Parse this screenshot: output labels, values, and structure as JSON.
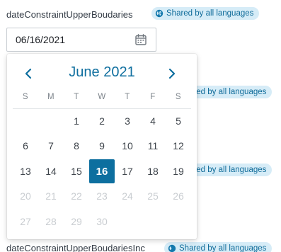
{
  "fields": [
    {
      "label": "dateConstraintUpperBoudaries",
      "badge": "Shared by all languages"
    },
    {
      "badge": "Shared by all languages"
    },
    {
      "badge": "Shared by all languages"
    },
    {
      "label": "dateConstraintUpperBoudariesInc",
      "badge": "Shared by all languages"
    }
  ],
  "date_input": {
    "value": "06/16/2021",
    "icon": "calendar-icon"
  },
  "picker": {
    "month_title": "June 2021",
    "prev_icon": "chevron-left-icon",
    "next_icon": "chevron-right-icon",
    "weekdays": [
      "S",
      "M",
      "T",
      "W",
      "T",
      "F",
      "S"
    ],
    "days": [
      {
        "label": "",
        "state": "empty"
      },
      {
        "label": "",
        "state": "empty"
      },
      {
        "label": "1",
        "state": "enabled"
      },
      {
        "label": "2",
        "state": "enabled"
      },
      {
        "label": "3",
        "state": "enabled"
      },
      {
        "label": "4",
        "state": "enabled"
      },
      {
        "label": "5",
        "state": "enabled"
      },
      {
        "label": "6",
        "state": "enabled"
      },
      {
        "label": "7",
        "state": "enabled"
      },
      {
        "label": "8",
        "state": "enabled"
      },
      {
        "label": "9",
        "state": "enabled"
      },
      {
        "label": "10",
        "state": "enabled"
      },
      {
        "label": "11",
        "state": "enabled"
      },
      {
        "label": "12",
        "state": "enabled"
      },
      {
        "label": "13",
        "state": "enabled"
      },
      {
        "label": "14",
        "state": "enabled"
      },
      {
        "label": "15",
        "state": "enabled"
      },
      {
        "label": "16",
        "state": "selected"
      },
      {
        "label": "17",
        "state": "enabled"
      },
      {
        "label": "18",
        "state": "enabled"
      },
      {
        "label": "19",
        "state": "enabled"
      },
      {
        "label": "20",
        "state": "disabled"
      },
      {
        "label": "21",
        "state": "disabled"
      },
      {
        "label": "22",
        "state": "disabled"
      },
      {
        "label": "23",
        "state": "disabled"
      },
      {
        "label": "24",
        "state": "disabled"
      },
      {
        "label": "25",
        "state": "disabled"
      },
      {
        "label": "26",
        "state": "disabled"
      },
      {
        "label": "27",
        "state": "disabled"
      },
      {
        "label": "28",
        "state": "disabled"
      },
      {
        "label": "29",
        "state": "disabled"
      },
      {
        "label": "30",
        "state": "disabled"
      }
    ]
  },
  "colors": {
    "accent": "#0d6f9f",
    "badge_bg": "#d6ecf7",
    "badge_text": "#106c9a",
    "disabled_day": "#c9cdd1"
  }
}
